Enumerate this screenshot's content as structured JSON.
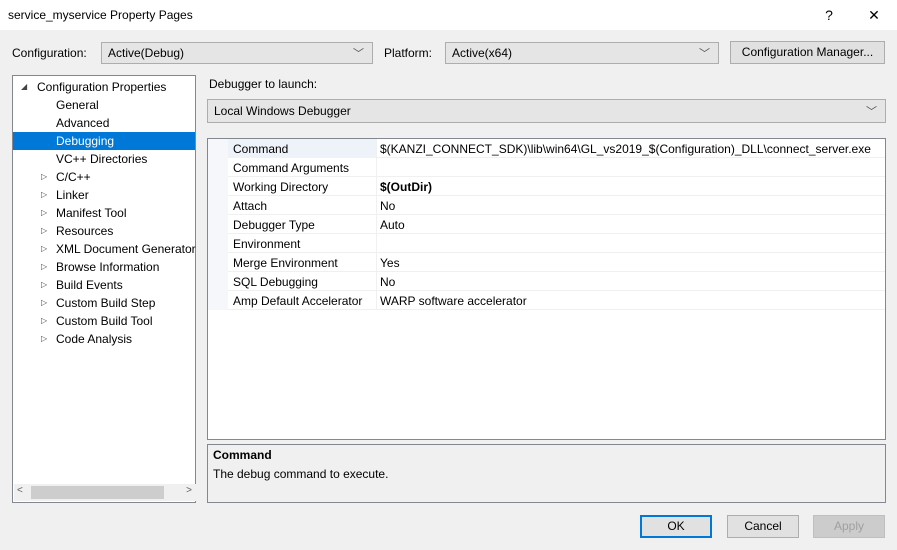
{
  "window": {
    "title": "service_myservice Property Pages",
    "help": "?",
    "close": "✕"
  },
  "config": {
    "label": "Configuration:",
    "value": "Active(Debug)",
    "platform_label": "Platform:",
    "platform_value": "Active(x64)",
    "manager_button": "Configuration Manager..."
  },
  "tree": {
    "root": "Configuration Properties",
    "items": [
      {
        "label": "General",
        "expandable": false
      },
      {
        "label": "Advanced",
        "expandable": false
      },
      {
        "label": "Debugging",
        "expandable": false,
        "selected": true
      },
      {
        "label": "VC++ Directories",
        "expandable": false
      },
      {
        "label": "C/C++",
        "expandable": true
      },
      {
        "label": "Linker",
        "expandable": true
      },
      {
        "label": "Manifest Tool",
        "expandable": true
      },
      {
        "label": "Resources",
        "expandable": true
      },
      {
        "label": "XML Document Generator",
        "expandable": true
      },
      {
        "label": "Browse Information",
        "expandable": true
      },
      {
        "label": "Build Events",
        "expandable": true
      },
      {
        "label": "Custom Build Step",
        "expandable": true
      },
      {
        "label": "Custom Build Tool",
        "expandable": true
      },
      {
        "label": "Code Analysis",
        "expandable": true
      }
    ]
  },
  "debugger": {
    "label": "Debugger to launch:",
    "value": "Local Windows Debugger"
  },
  "properties": [
    {
      "name": "Command",
      "value": "$(KANZI_CONNECT_SDK)\\lib\\win64\\GL_vs2019_$(Configuration)_DLL\\connect_server.exe"
    },
    {
      "name": "Command Arguments",
      "value": ""
    },
    {
      "name": "Working Directory",
      "value": "$(OutDir)",
      "bold": true
    },
    {
      "name": "Attach",
      "value": "No"
    },
    {
      "name": "Debugger Type",
      "value": "Auto"
    },
    {
      "name": "Environment",
      "value": ""
    },
    {
      "name": "Merge Environment",
      "value": "Yes"
    },
    {
      "name": "SQL Debugging",
      "value": "No"
    },
    {
      "name": "Amp Default Accelerator",
      "value": "WARP software accelerator"
    }
  ],
  "description": {
    "title": "Command",
    "text": "The debug command to execute."
  },
  "buttons": {
    "ok": "OK",
    "cancel": "Cancel",
    "apply": "Apply"
  }
}
